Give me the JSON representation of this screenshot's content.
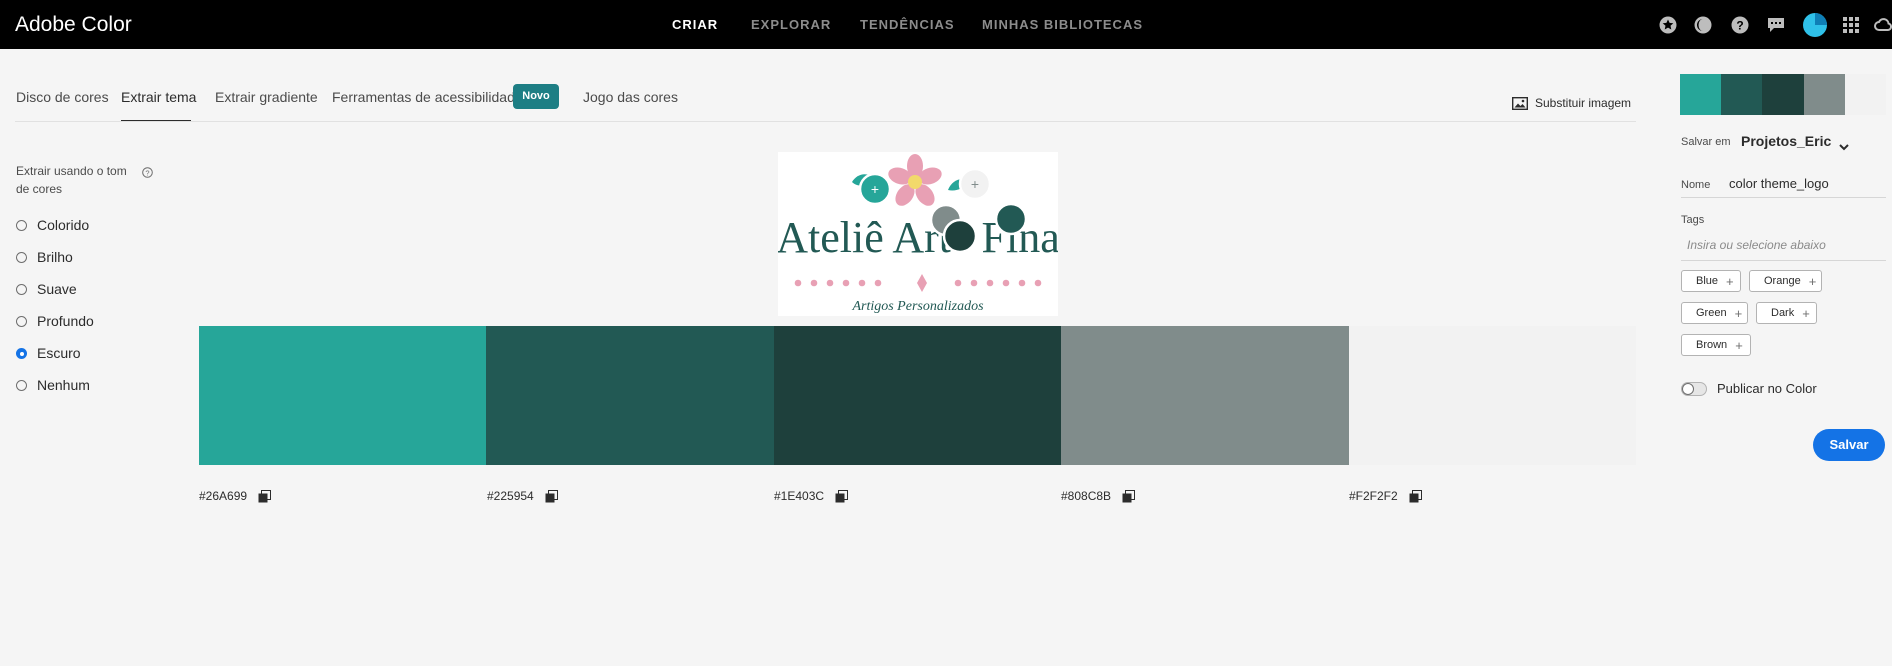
{
  "app": {
    "title": "Adobe Color"
  },
  "topnav": {
    "items": [
      {
        "label": "CRIAR",
        "active": true
      },
      {
        "label": "EXPLORAR",
        "active": false
      },
      {
        "label": "TENDÊNCIAS",
        "active": false
      },
      {
        "label": "MINHAS BIBLIOTECAS",
        "active": false
      }
    ],
    "icons": [
      "star-icon",
      "theme-icon",
      "help-icon",
      "feedback-icon",
      "avatar",
      "apps-grid-icon",
      "creative-cloud-icon"
    ]
  },
  "tabs": [
    {
      "label": "Disco de cores",
      "active": false
    },
    {
      "label": "Extrair tema",
      "active": true
    },
    {
      "label": "Extrair gradiente",
      "active": false
    },
    {
      "label": "Ferramentas de acessibilidade",
      "active": false
    },
    {
      "label": "Jogo das cores",
      "active": false
    }
  ],
  "badge": {
    "label": "Novo"
  },
  "replace_image": {
    "label": "Substituir imagem"
  },
  "extract": {
    "label": "Extrair usando o tom de cores",
    "options": [
      {
        "label": "Colorido",
        "selected": false
      },
      {
        "label": "Brilho",
        "selected": false
      },
      {
        "label": "Suave",
        "selected": false
      },
      {
        "label": "Profundo",
        "selected": false
      },
      {
        "label": "Escuro",
        "selected": true
      },
      {
        "label": "Nenhum",
        "selected": false
      }
    ]
  },
  "image": {
    "title_text": "Ateliê Arte Fina",
    "subtitle_text": "Artigos Personalizados"
  },
  "palette": [
    {
      "hex": "#26A699",
      "color": "#26A699"
    },
    {
      "hex": "#225954",
      "color": "#225954"
    },
    {
      "hex": "#1E403C",
      "color": "#1E403C"
    },
    {
      "hex": "#808C8B",
      "color": "#808C8B"
    },
    {
      "hex": "#F2F2F2",
      "color": "#F2F2F2"
    }
  ],
  "save_panel": {
    "save_in_label": "Salvar em",
    "project": "Projetos_Eric",
    "name_label": "Nome",
    "name_value": "color theme_logo",
    "tags_label": "Tags",
    "tags_placeholder": "Insira ou selecione abaixo",
    "tags": [
      "Blue",
      "Orange",
      "Green",
      "Dark",
      "Brown"
    ],
    "publish_label": "Publicar no Color",
    "publish_on": false,
    "save_label": "Salvar"
  },
  "colors": {
    "accent": "#1473E6",
    "badge": "#1D7E84",
    "topbar": "#000000"
  }
}
